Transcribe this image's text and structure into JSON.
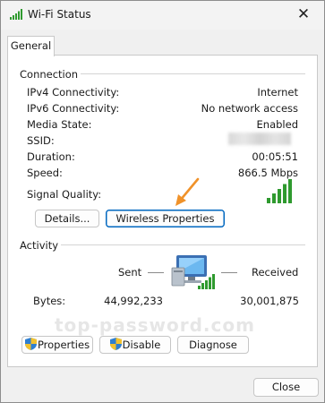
{
  "window": {
    "title": "Wi-Fi Status",
    "close_glyph": "✕"
  },
  "tabs": [
    {
      "label": "General"
    }
  ],
  "connection": {
    "section_label": "Connection",
    "rows": [
      {
        "label": "IPv4 Connectivity:",
        "value": "Internet"
      },
      {
        "label": "IPv6 Connectivity:",
        "value": "No network access"
      },
      {
        "label": "Media State:",
        "value": "Enabled"
      },
      {
        "label": "SSID:",
        "value": ""
      },
      {
        "label": "Duration:",
        "value": "00:05:51"
      },
      {
        "label": "Speed:",
        "value": "866.5 Mbps"
      }
    ],
    "signal_label": "Signal Quality:",
    "signal_bars": 5,
    "details_button": "Details...",
    "wireless_properties_button": "Wireless Properties"
  },
  "activity": {
    "section_label": "Activity",
    "sent_label": "Sent",
    "received_label": "Received",
    "bytes_label": "Bytes:",
    "bytes_sent": "44,992,233",
    "bytes_received": "30,001,875"
  },
  "buttons": {
    "properties": "Properties",
    "disable": "Disable",
    "diagnose": "Diagnose",
    "close": "Close"
  },
  "watermark": "top-password.com",
  "colors": {
    "signal_green": "#2f9a2f",
    "arrow_orange": "#f0922a",
    "accent_blue": "#0067c0"
  }
}
